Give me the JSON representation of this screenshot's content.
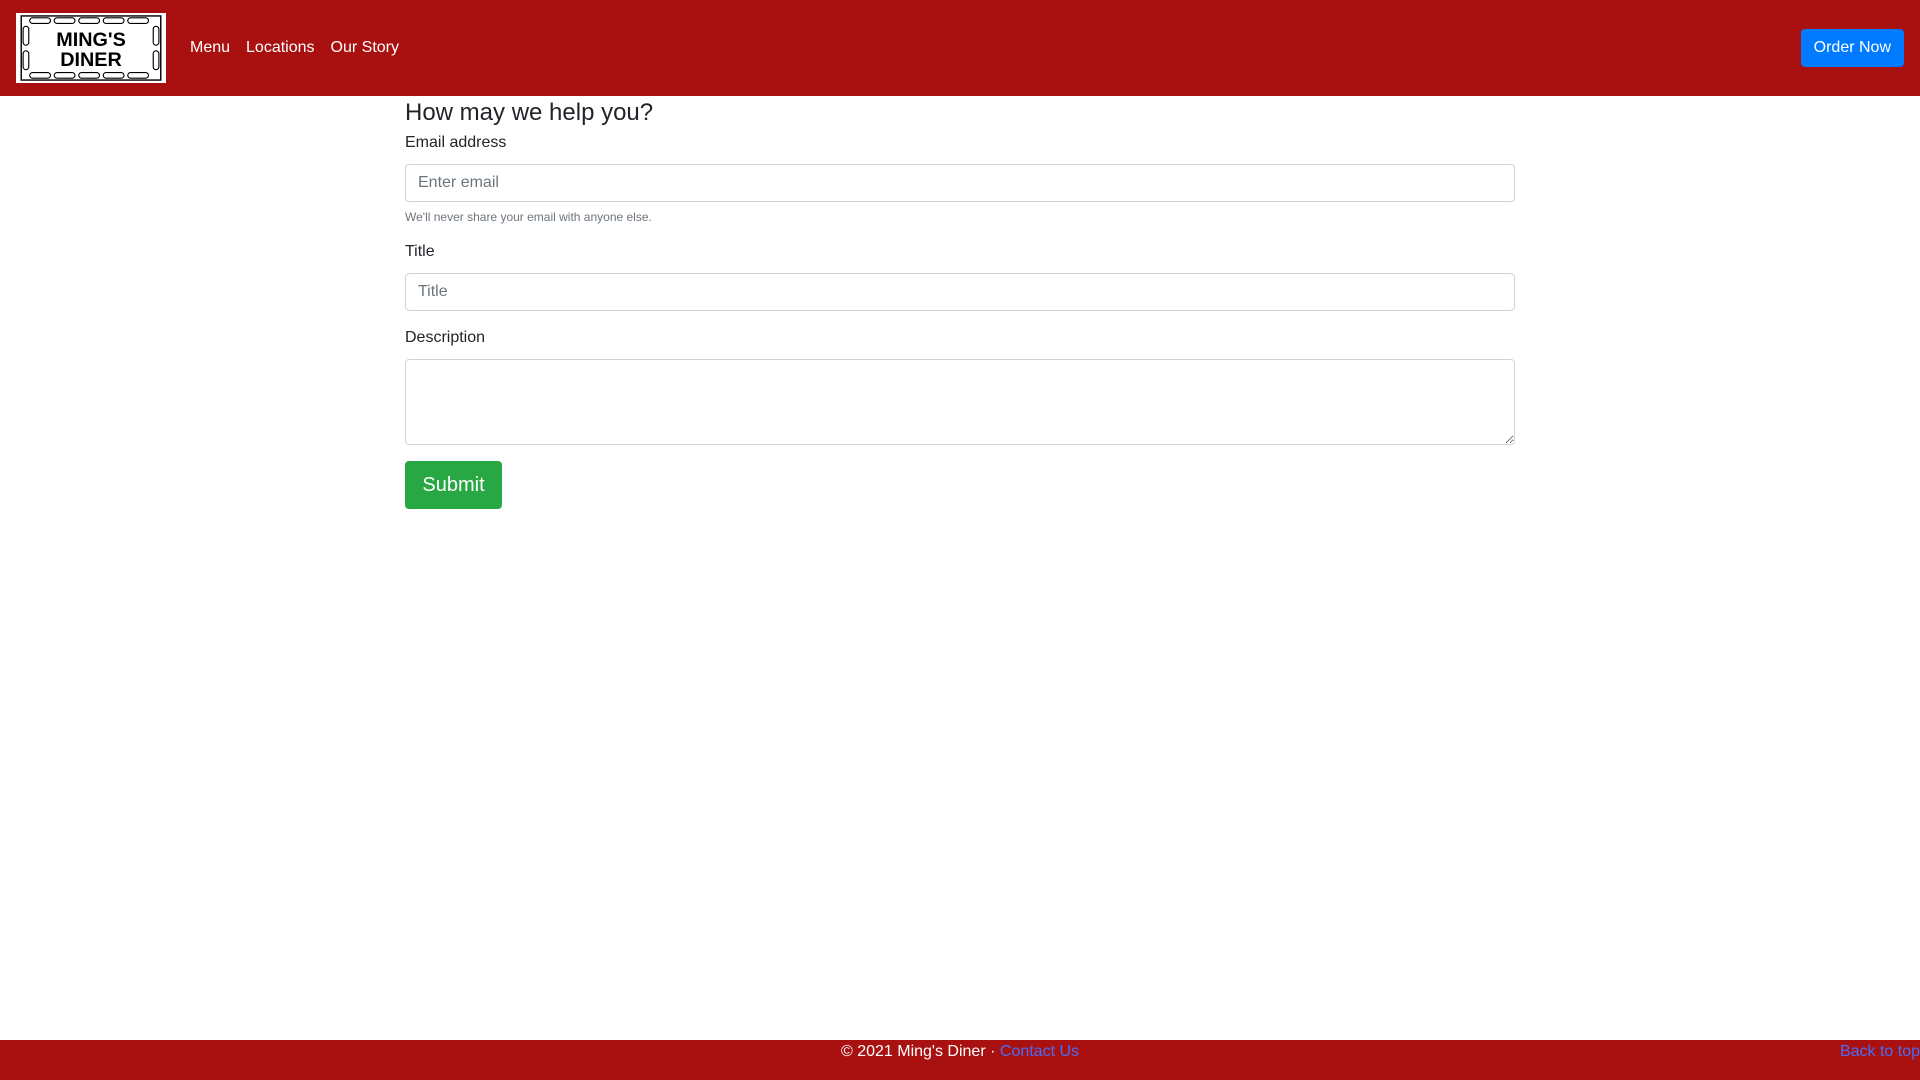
{
  "brand": {
    "logo_line1": "Ming's",
    "logo_line2": "Diner"
  },
  "nav": {
    "links": [
      {
        "label": "Menu"
      },
      {
        "label": "Locations"
      },
      {
        "label": "Our Story"
      }
    ],
    "order_label": "Order Now"
  },
  "form": {
    "heading": "How may we help you?",
    "email_label": "Email address",
    "email_placeholder": "Enter email",
    "email_help": "We'll never share your email with anyone else.",
    "title_label": "Title",
    "title_placeholder": "Title",
    "description_label": "Description",
    "submit_label": "Submit"
  },
  "footer": {
    "copyright": "© 2021 Ming's Diner · ",
    "contact_label": "Contact Us",
    "back_to_top_label": "Back to top"
  },
  "colors": {
    "brand_red": "#a91111",
    "primary_blue": "#007bff",
    "success_green": "#28a745"
  }
}
